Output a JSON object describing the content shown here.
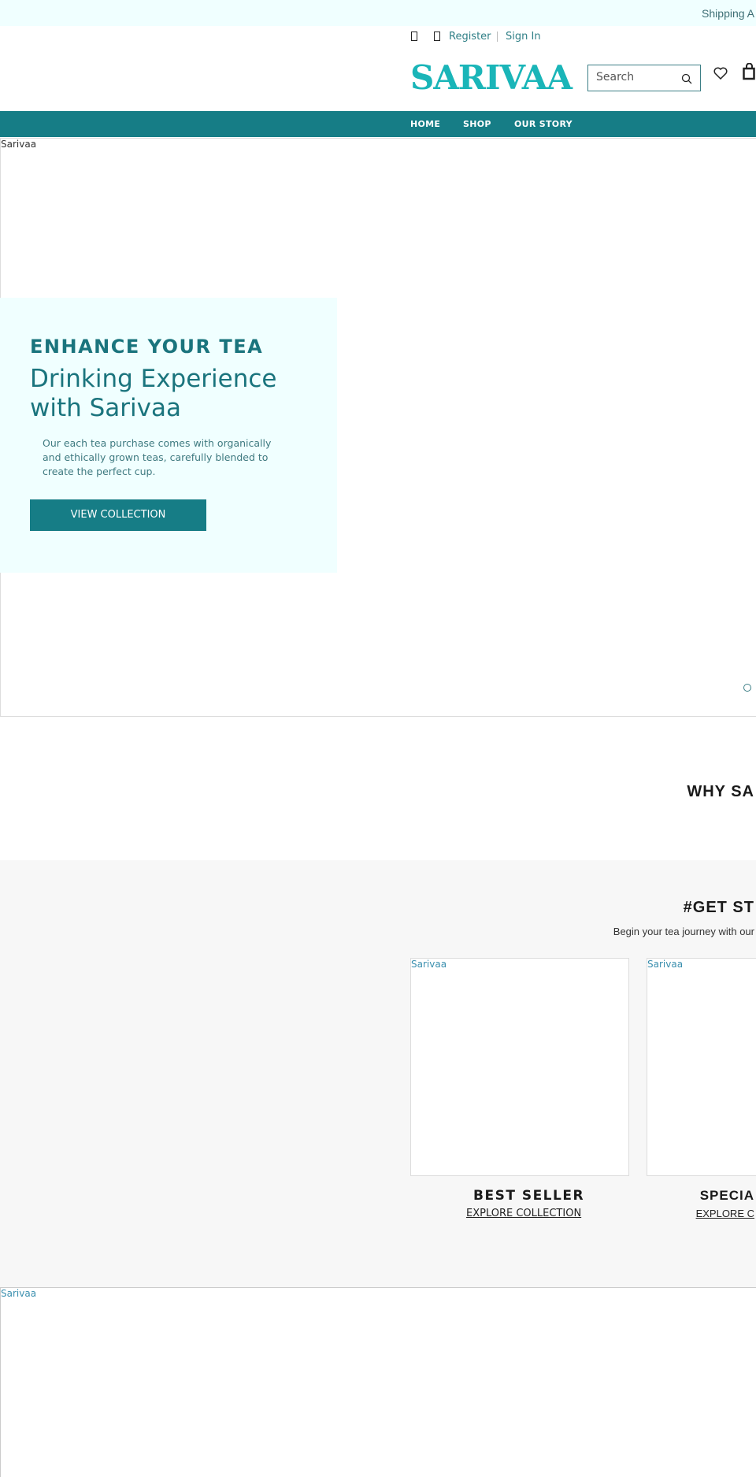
{
  "topbar": {
    "shipping": "Shipping A"
  },
  "header": {
    "register": "Register",
    "sign_in": "Sign In",
    "logo": "SARIVAA",
    "search_placeholder": "Search"
  },
  "nav": {
    "items": [
      "HOME",
      "SHOP",
      "OUR STORY"
    ]
  },
  "hero": {
    "image_alt": "Sarivaa",
    "heading": "ENHANCE YOUR TEA",
    "subheading_line1": "Drinking Experience",
    "subheading_line2": "with Sarivaa",
    "body": "Our each tea purchase comes with organically and ethically grown teas, carefully blended to create the perfect cup.",
    "button": "VIEW COLLECTION"
  },
  "why": {
    "title": "WHY SA"
  },
  "get_started": {
    "title": "#GET ST",
    "subtitle": "Begin your tea journey with our",
    "cards": [
      {
        "image_alt": "Sarivaa",
        "title": "BEST SELLER",
        "link": "EXPLORE COLLECTION"
      },
      {
        "image_alt": "Sarivaa",
        "title": "SPECIA",
        "link": "EXPLORE C"
      }
    ]
  },
  "bottom": {
    "image_alt": "Sarivaa"
  },
  "colors": {
    "brand": "#167d86",
    "logo": "#1ab5b8",
    "tint": "#f0ffff"
  }
}
